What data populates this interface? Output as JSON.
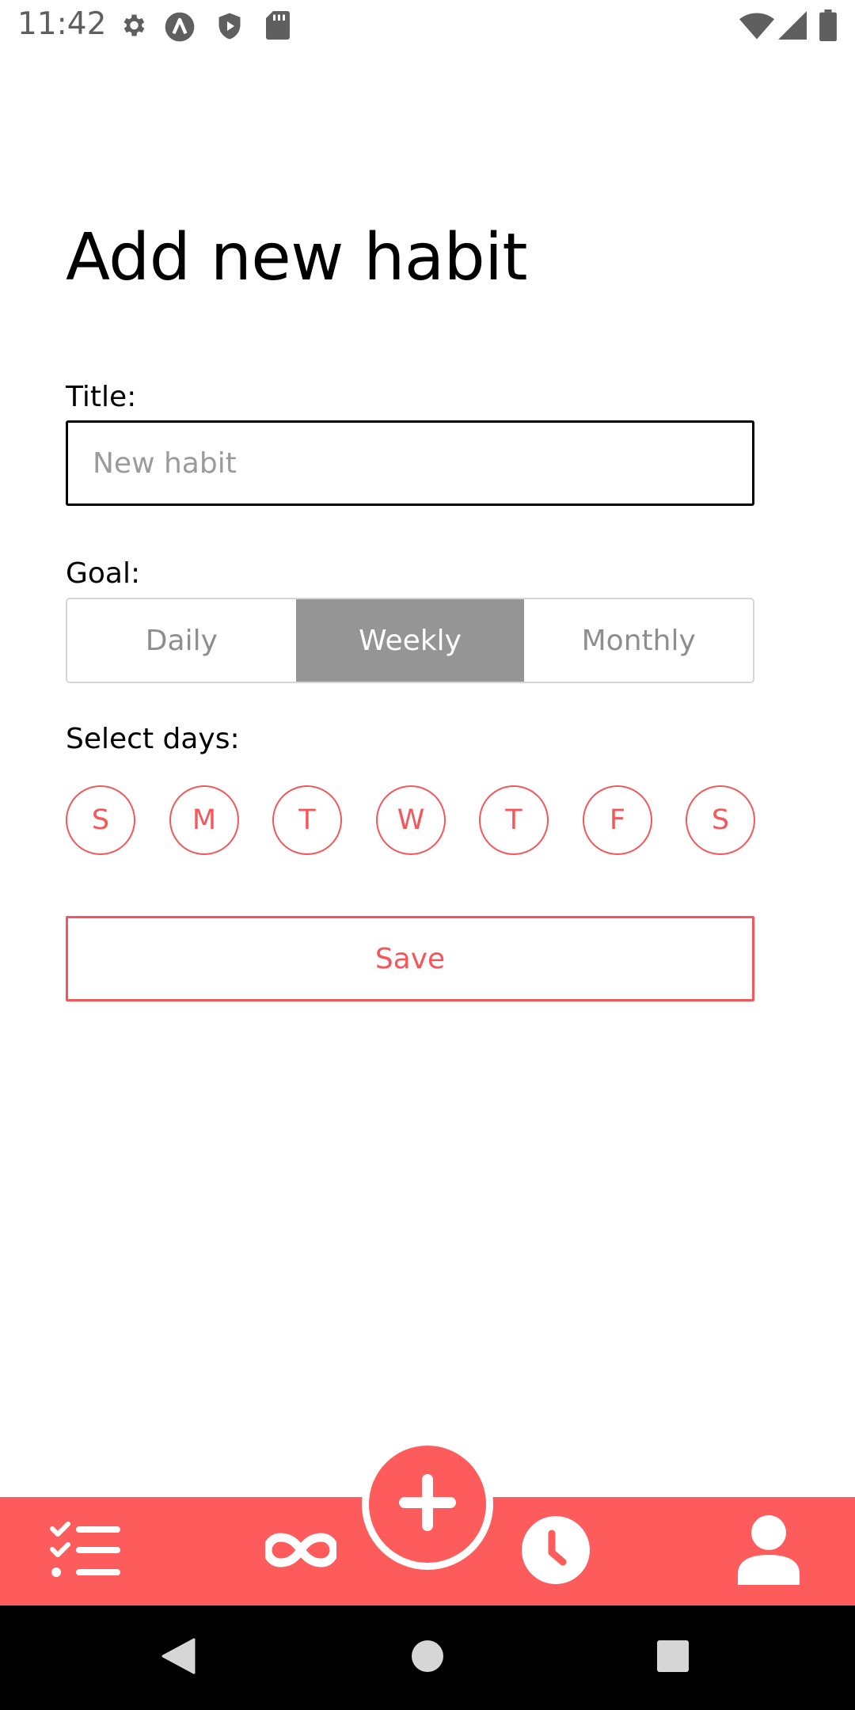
{
  "status_bar": {
    "time": "11:42",
    "icons": [
      "gear-icon",
      "a-circle-icon",
      "shield-play-icon",
      "sd-card-icon",
      "wifi-icon",
      "cell-signal-icon",
      "battery-icon"
    ]
  },
  "page": {
    "title": "Add new habit",
    "title_label": "Title:",
    "title_placeholder": "New habit",
    "title_value": "",
    "goal_label": "Goal:",
    "goal_options": [
      "Daily",
      "Weekly",
      "Monthly"
    ],
    "goal_selected": "Weekly",
    "days_label": "Select days:",
    "days": [
      "S",
      "M",
      "T",
      "W",
      "T",
      "F",
      "S"
    ],
    "save_label": "Save"
  },
  "bottom_nav": {
    "items": [
      "checklist-icon",
      "infinity-icon",
      "add-icon",
      "clock-icon",
      "user-icon"
    ]
  },
  "system_nav": {
    "items": [
      "back-icon",
      "home-icon",
      "recents-icon"
    ]
  },
  "colors": {
    "accent": "#fe5c5c",
    "accent_text": "#f4565a",
    "segment_active": "#959595",
    "segment_text": "#8e8e8e"
  }
}
